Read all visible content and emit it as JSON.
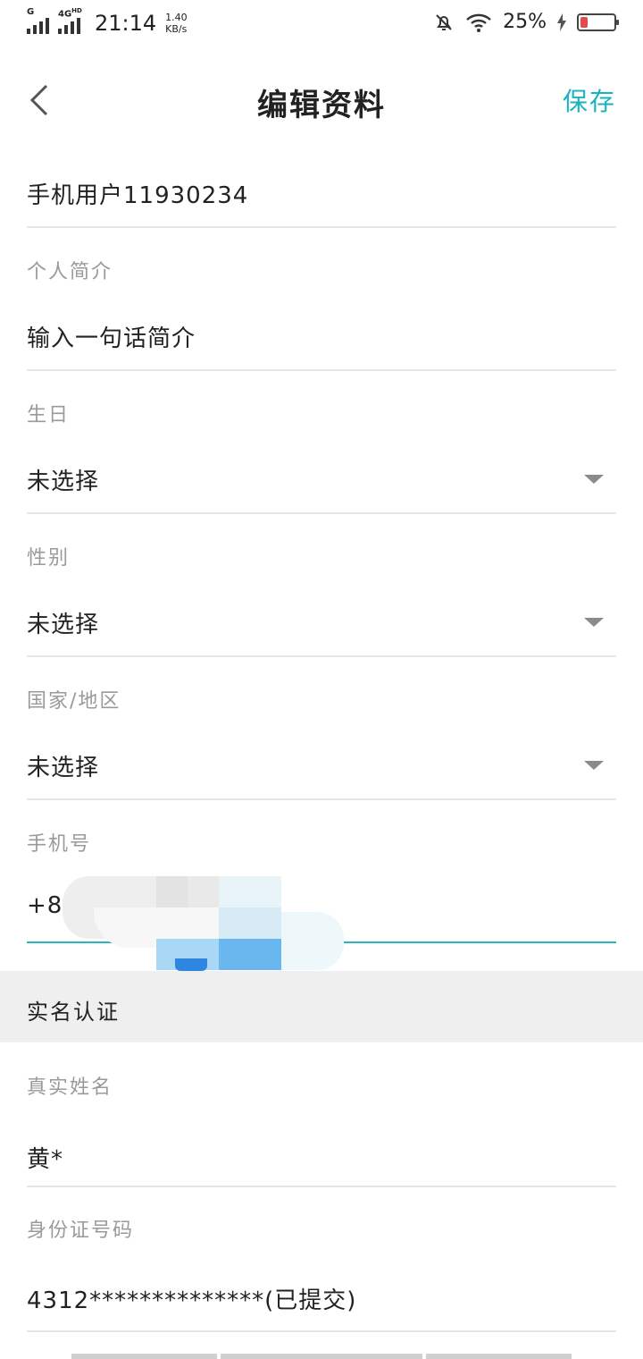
{
  "status_bar": {
    "carrier_1": "G",
    "carrier_2": "4G",
    "carrier_2_sup": "HD",
    "time": "21:14",
    "speed_value": "1.40",
    "speed_unit": "KB/s",
    "battery": "25%"
  },
  "header": {
    "title": "编辑资料",
    "save_label": "保存"
  },
  "form": {
    "nickname": "手机用户11930234",
    "bio_label": "个人简介",
    "bio_placeholder": "输入一句话简介",
    "birthday_label": "生日",
    "birthday_value": "未选择",
    "gender_label": "性别",
    "gender_value": "未选择",
    "country_label": "国家/地区",
    "country_value": "未选择",
    "phone_label": "手机号",
    "phone_value": "+86"
  },
  "verification": {
    "section_title": "实名认证",
    "name_label": "真实姓名",
    "name_value": "黄*",
    "id_label": "身份证号码",
    "id_value": "4312**************(已提交)"
  },
  "colors": {
    "accent": "#17b3bf",
    "label": "#9a9a9a",
    "text": "#222222",
    "section_bg": "#efefef"
  }
}
